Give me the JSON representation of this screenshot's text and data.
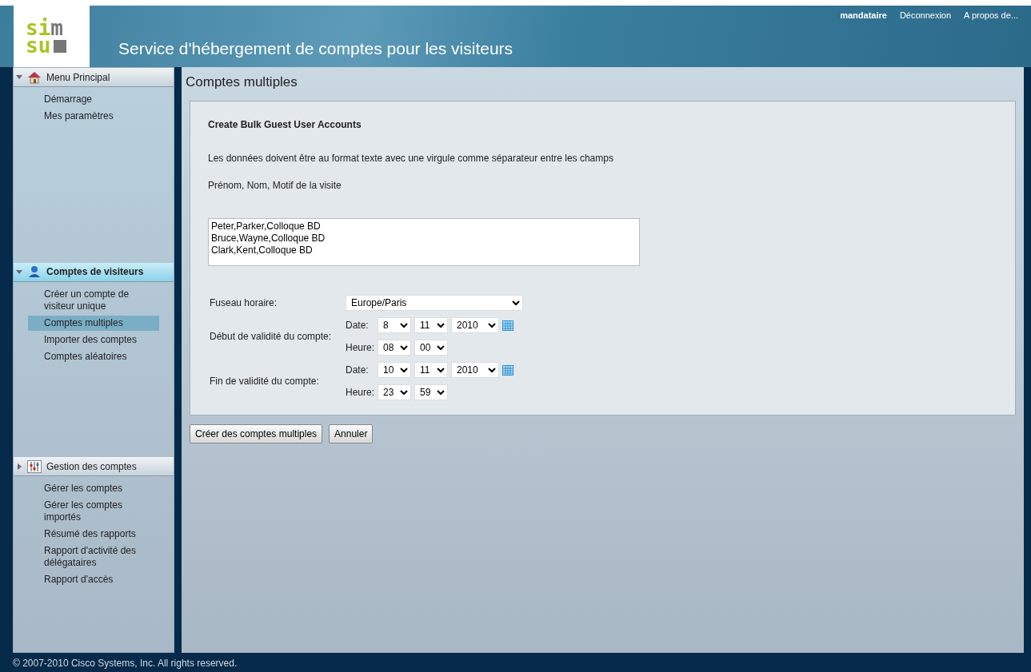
{
  "header": {
    "logo_top": "si",
    "logo_top_right": "m",
    "logo_bottom": "su",
    "title": "Service d'hébergement de comptes pour les visiteurs",
    "user": "mandataire",
    "links": [
      "Déconnexion",
      "A propos de..."
    ]
  },
  "sidebar": {
    "sections": [
      {
        "title": "Menu Principal",
        "expanded": true,
        "selected": false,
        "items": [
          {
            "label": "Démarrage",
            "selected": false
          },
          {
            "label": "Mes paramètres",
            "selected": false
          }
        ]
      },
      {
        "title": "Comptes de visiteurs",
        "expanded": true,
        "selected": true,
        "items": [
          {
            "label": "Créer un compte de visiteur unique",
            "selected": false
          },
          {
            "label": "Comptes multiples",
            "selected": true
          },
          {
            "label": "Importer des comptes",
            "selected": false
          },
          {
            "label": "Comptes aléatoires",
            "selected": false
          }
        ]
      },
      {
        "title": "Gestion des comptes",
        "expanded": false,
        "selected": false,
        "items": [
          {
            "label": "Gérer les comptes",
            "selected": false
          },
          {
            "label": "Gérer les comptes importés",
            "selected": false
          },
          {
            "label": "Résumé des rapports",
            "selected": false
          },
          {
            "label": "Rapport d'activité des délégataires",
            "selected": false
          },
          {
            "label": "Rapport d'accès",
            "selected": false
          }
        ]
      }
    ]
  },
  "main": {
    "title": "Comptes multiples",
    "form_title": "Create Bulk Guest User Accounts",
    "instructions": [
      "Les données doivent être au format texte avec une virgule comme séparateur entre les champs",
      "Prénom, Nom, Motif de la visite"
    ],
    "accounts_text": "Peter,Parker,Colloque BD\nBruce,Wayne,Colloque BD\nClark,Kent,Colloque BD",
    "timezone": {
      "label": "Fuseau horaire:",
      "value": "Europe/Paris"
    },
    "validity": [
      {
        "label": "Début de validité du compte:",
        "date_label": "Date:",
        "day": "8",
        "month": "11",
        "year": "2010",
        "time_label": "Heure:",
        "hour": "08",
        "minute": "00"
      },
      {
        "label": "Fin de validité du compte:",
        "date_label": "Date:",
        "day": "10",
        "month": "11",
        "year": "2010",
        "time_label": "Heure:",
        "hour": "23",
        "minute": "59"
      }
    ],
    "buttons": [
      "Créer des comptes multiples",
      "Annuler"
    ]
  },
  "footer": "© 2007-2010 Cisco Systems, Inc. All rights reserved."
}
